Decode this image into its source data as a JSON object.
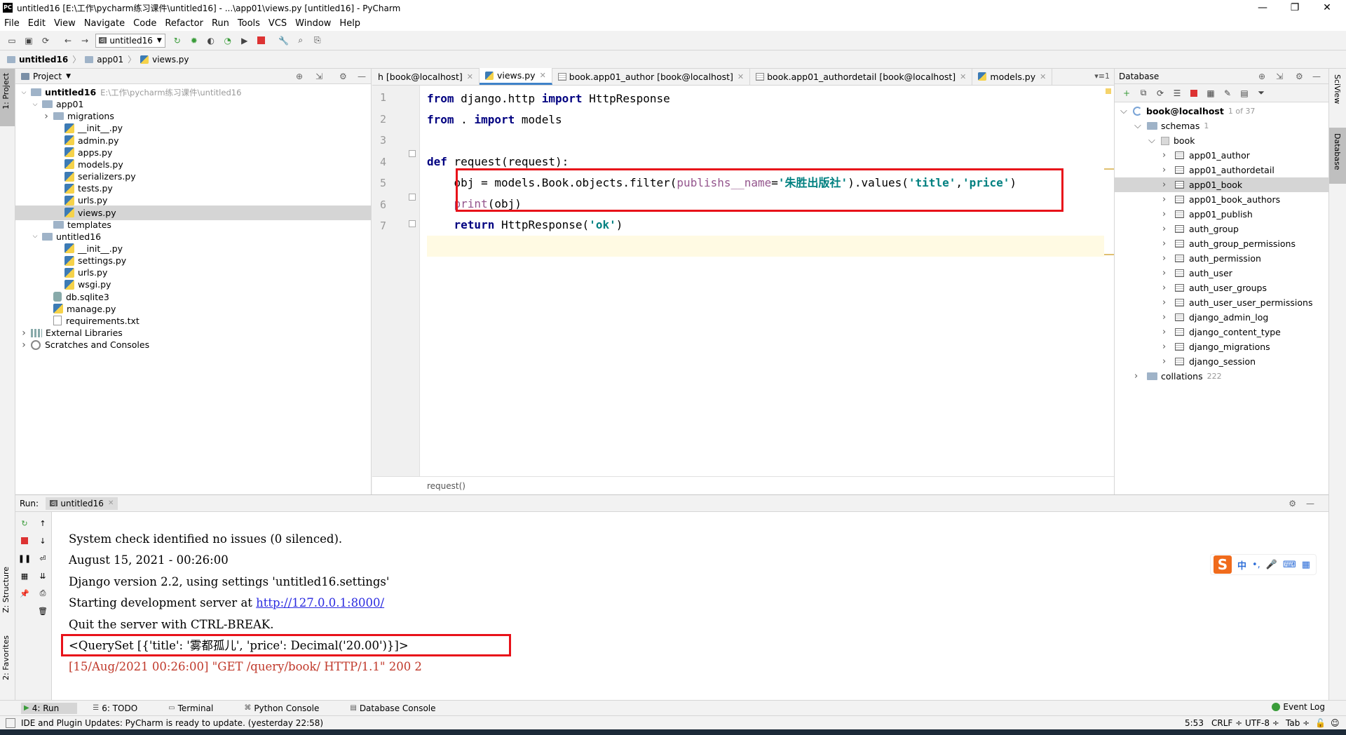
{
  "window": {
    "title": "untitled16 [E:\\工作\\pycharm练习课件\\untitled16] - ...\\app01\\views.py [untitled16] - PyCharm",
    "app_icon": "PC"
  },
  "menu": [
    "File",
    "Edit",
    "View",
    "Navigate",
    "Code",
    "Refactor",
    "Run",
    "Tools",
    "VCS",
    "Window",
    "Help"
  ],
  "toolbar": {
    "run_config": "untitled16"
  },
  "breadcrumb": [
    "untitled16",
    "app01",
    "views.py"
  ],
  "left_stripe": {
    "project_tab": "1: Project",
    "structure_tab": "Z: Structure",
    "favorites_tab": "2: Favorites"
  },
  "project": {
    "header": "Project",
    "tree": [
      {
        "label": "untitled16",
        "note": "E:\\工作\\pycharm练习课件\\untitled16",
        "type": "folder",
        "level": 0,
        "open": true
      },
      {
        "label": "app01",
        "type": "folder",
        "level": 1,
        "open": true
      },
      {
        "label": "migrations",
        "type": "folder",
        "level": 2,
        "open": false
      },
      {
        "label": "__init__.py",
        "type": "py",
        "level": 3
      },
      {
        "label": "admin.py",
        "type": "py",
        "level": 3
      },
      {
        "label": "apps.py",
        "type": "py",
        "level": 3
      },
      {
        "label": "models.py",
        "type": "py",
        "level": 3
      },
      {
        "label": "serializers.py",
        "type": "py",
        "level": 3
      },
      {
        "label": "tests.py",
        "type": "py",
        "level": 3
      },
      {
        "label": "urls.py",
        "type": "py",
        "level": 3
      },
      {
        "label": "views.py",
        "type": "py",
        "level": 3,
        "selected": true
      },
      {
        "label": "templates",
        "type": "folder",
        "level": 2
      },
      {
        "label": "untitled16",
        "type": "folder",
        "level": 1,
        "open": true
      },
      {
        "label": "__init__.py",
        "type": "py",
        "level": 3
      },
      {
        "label": "settings.py",
        "type": "py",
        "level": 3
      },
      {
        "label": "urls.py",
        "type": "py",
        "level": 3
      },
      {
        "label": "wsgi.py",
        "type": "py",
        "level": 3
      },
      {
        "label": "db.sqlite3",
        "type": "db",
        "level": 2
      },
      {
        "label": "manage.py",
        "type": "py",
        "level": 2
      },
      {
        "label": "requirements.txt",
        "type": "txt",
        "level": 2
      },
      {
        "label": "External Libraries",
        "type": "lib",
        "level": 0,
        "open": false
      },
      {
        "label": "Scratches and Consoles",
        "type": "scratch",
        "level": 0,
        "open": false
      }
    ]
  },
  "editor": {
    "tabs": [
      {
        "label": "h [book@localhost]",
        "active": false
      },
      {
        "label": "views.py",
        "active": true
      },
      {
        "label": "book.app01_author [book@localhost]",
        "active": false
      },
      {
        "label": "book.app01_authordetail [book@localhost]",
        "active": false
      },
      {
        "label": "models.py",
        "active": false
      }
    ],
    "tab_overflow": "▾≡1",
    "line_numbers": [
      "1",
      "2",
      "3",
      "4",
      "5",
      "6",
      "7"
    ],
    "code": {
      "l1_kw1": "from",
      "l1_mod": " django.http ",
      "l1_kw2": "import",
      "l1_name": " HttpResponse",
      "l2_kw1": "from",
      "l2_mod": " . ",
      "l2_kw2": "import",
      "l2_name": " models",
      "l4_kw": "def",
      "l4_rest": " request(request):",
      "l5_a": "    obj = models.Book.objects.filter(",
      "l5_param": "publishs__name",
      "l5_eq": "=",
      "l5_str1": "'朱胜出版社'",
      "l5_b": ").values(",
      "l5_str2": "'title'",
      "l5_c": ",",
      "l5_str3": "'price'",
      "l5_d": ")",
      "l6_fn": "    print",
      "l6_rest": "(obj)",
      "l7_kw": "    return",
      "l7_rest": " HttpResponse(",
      "l7_str": "'ok'",
      "l7_end": ")"
    },
    "context_crumb": "request()"
  },
  "database": {
    "header": "Database",
    "tree": [
      {
        "label": "book@localhost",
        "note": "1 of 37",
        "type": "conn",
        "level": 0,
        "open": true
      },
      {
        "label": "schemas",
        "note": "1",
        "type": "folder",
        "level": 1,
        "open": true
      },
      {
        "label": "book",
        "type": "schema",
        "level": 2,
        "open": true
      },
      {
        "label": "app01_author",
        "type": "table",
        "level": 3
      },
      {
        "label": "app01_authordetail",
        "type": "table",
        "level": 3
      },
      {
        "label": "app01_book",
        "type": "table",
        "level": 3,
        "selected": true
      },
      {
        "label": "app01_book_authors",
        "type": "table",
        "level": 3
      },
      {
        "label": "app01_publish",
        "type": "table",
        "level": 3
      },
      {
        "label": "auth_group",
        "type": "table",
        "level": 3
      },
      {
        "label": "auth_group_permissions",
        "type": "table",
        "level": 3
      },
      {
        "label": "auth_permission",
        "type": "table",
        "level": 3
      },
      {
        "label": "auth_user",
        "type": "table",
        "level": 3
      },
      {
        "label": "auth_user_groups",
        "type": "table",
        "level": 3
      },
      {
        "label": "auth_user_user_permissions",
        "type": "table",
        "level": 3
      },
      {
        "label": "django_admin_log",
        "type": "table",
        "level": 3
      },
      {
        "label": "django_content_type",
        "type": "table",
        "level": 3
      },
      {
        "label": "django_migrations",
        "type": "table",
        "level": 3
      },
      {
        "label": "django_session",
        "type": "table",
        "level": 3
      },
      {
        "label": "collations",
        "note": "222",
        "type": "folder",
        "level": 1,
        "open": false
      }
    ]
  },
  "right_stripe": {
    "sciview": "SciView",
    "database": "Database"
  },
  "run": {
    "label": "Run:",
    "tab": "untitled16",
    "console": [
      {
        "text": "System check identified no issues (0 silenced).",
        "kind": "normal"
      },
      {
        "text": "August 15, 2021 - 00:26:00",
        "kind": "normal"
      },
      {
        "text": "Django version 2.2, using settings 'untitled16.settings'",
        "kind": "normal"
      },
      {
        "text": "Starting development server at ",
        "link": "http://127.0.0.1:8000/",
        "kind": "normal"
      },
      {
        "text": "Quit the server with CTRL-BREAK.",
        "kind": "normal"
      },
      {
        "text": "<QuerySet [{'title': '雾都孤儿', 'price': Decimal('20.00')}]>",
        "kind": "normal"
      },
      {
        "text": "[15/Aug/2021 00:26:00] \"GET /query/book/ HTTP/1.1\" 200 2",
        "kind": "error"
      }
    ]
  },
  "ime": {
    "logo": "S",
    "mode": "中",
    "punct": "•,"
  },
  "bottom_tools": [
    "4: Run",
    "6: TODO",
    "Terminal",
    "Python Console",
    "Database Console"
  ],
  "event_log": "Event Log",
  "status": {
    "message": "IDE and Plugin Updates: PyCharm is ready to update. (yesterday 22:58)",
    "position": "5:53",
    "line_sep": "CRLF ÷",
    "encoding": "UTF-8 ÷",
    "indent": "Tab ÷"
  }
}
